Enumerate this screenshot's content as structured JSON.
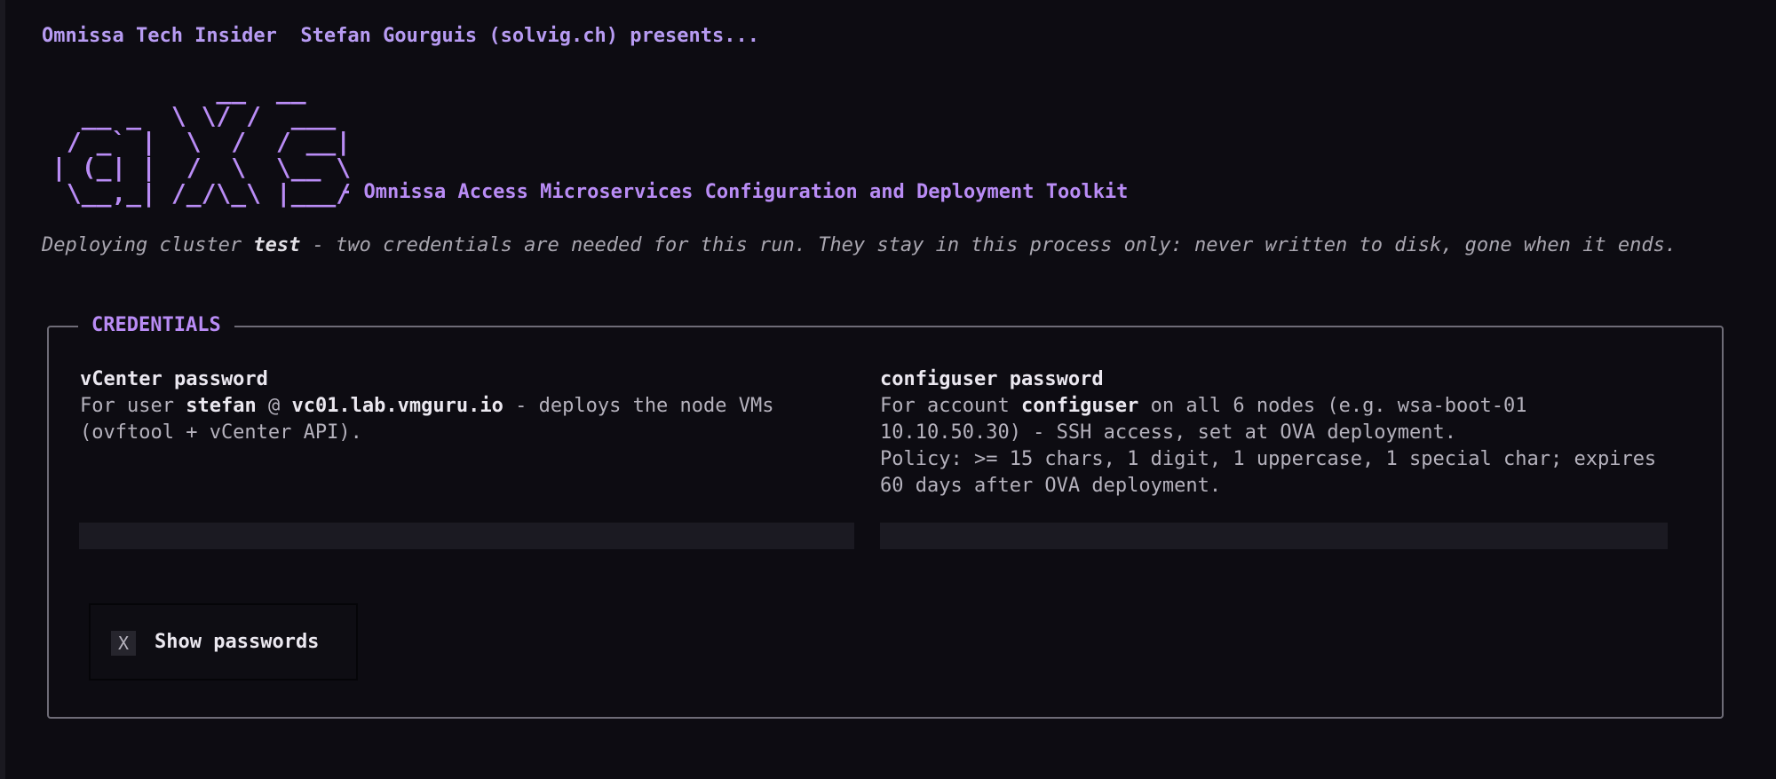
{
  "header": {
    "brand": "Omnissa Tech Insider",
    "presenter": "Stefan Gourguis (solvig.ch) presents..."
  },
  "logo": {
    "ascii": "           __  __\n  __ _  \\ \\/ /  ___\n / _` |  \\  /  / __|\n| (_| |  /  \\  \\__ \\\n \\__,_| /_/\\_\\ |___/",
    "tagline": "- Omnissa Access Microservices Configuration and Deployment Toolkit"
  },
  "intro": {
    "prefix": "Deploying cluster ",
    "cluster": "test",
    "suffix": " - two credentials are needed for this run. They stay in this process only: never written to disk, gone when it ends."
  },
  "credentials": {
    "legend": "CREDENTIALS",
    "vcenter": {
      "title": "vCenter password",
      "desc_prefix": "For user ",
      "user": "stefan",
      "desc_at": " @ ",
      "host": "vc01.lab.vmguru.io",
      "desc_suffix": " - deploys the node VMs (ovftool + vCenter API).",
      "value": ""
    },
    "configuser": {
      "title": "configuser password",
      "desc_prefix": "For account ",
      "account": "configuser",
      "desc_suffix": " on all 6 nodes (e.g. wsa-boot-01 10.10.50.30) - SSH access, set at OVA deployment.",
      "policy": "Policy: >= 15 chars, 1 digit, 1 uppercase, 1 special char; expires 60 days after OVA deployment.",
      "value": ""
    },
    "show_passwords": {
      "checkbox_mark": "X",
      "label": "Show passwords"
    }
  },
  "colors": {
    "background": "#0d0c12",
    "accent": "#b98cf5",
    "field": "#1b1a22",
    "border": "#6e6c77"
  }
}
